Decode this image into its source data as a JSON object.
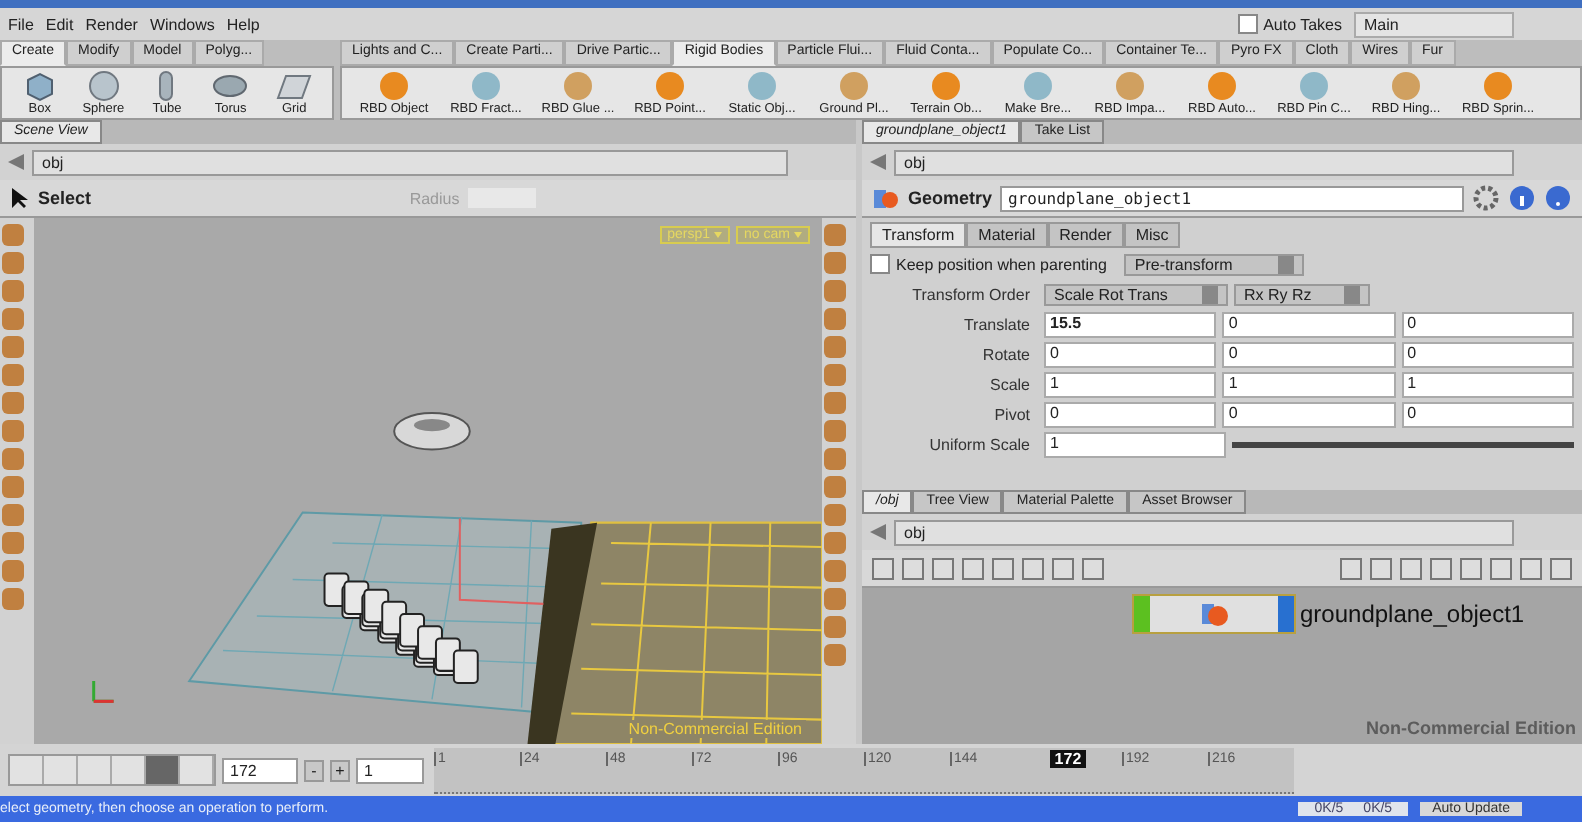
{
  "menu": [
    "File",
    "Edit",
    "Render",
    "Windows",
    "Help"
  ],
  "auto_takes": {
    "label": "Auto Takes",
    "checked": false
  },
  "take": "Main",
  "left_shelf": {
    "tabs": [
      {
        "label": "Create",
        "selected": true
      },
      {
        "label": "Modify",
        "selected": false
      },
      {
        "label": "Model",
        "selected": false
      },
      {
        "label": "Polyg...",
        "selected": false
      }
    ],
    "tools": [
      "Box",
      "Sphere",
      "Tube",
      "Torus",
      "Grid"
    ]
  },
  "right_shelf": {
    "tabs": [
      {
        "label": "Lights and C...",
        "selected": false
      },
      {
        "label": "Create Parti...",
        "selected": false
      },
      {
        "label": "Drive Partic...",
        "selected": false
      },
      {
        "label": "Rigid Bodies",
        "selected": true
      },
      {
        "label": "Particle Flui...",
        "selected": false
      },
      {
        "label": "Fluid Conta...",
        "selected": false
      },
      {
        "label": "Populate Co...",
        "selected": false
      },
      {
        "label": "Container Te...",
        "selected": false
      },
      {
        "label": "Pyro FX",
        "selected": false
      },
      {
        "label": "Cloth",
        "selected": false
      },
      {
        "label": "Wires",
        "selected": false
      },
      {
        "label": "Fur",
        "selected": false
      }
    ],
    "tools": [
      "RBD Object",
      "RBD Fract...",
      "RBD Glue ...",
      "RBD Point...",
      "Static Obj...",
      "Ground Pl...",
      "Terrain Ob...",
      "Make Bre...",
      "RBD Impa...",
      "RBD Auto...",
      "RBD Pin C...",
      "RBD Hing...",
      "RBD Sprin..."
    ]
  },
  "scene_view": {
    "tab": "Scene View",
    "path": "obj",
    "tool": "Select",
    "radius_label": "Radius",
    "camera": "persp1",
    "view": "no cam",
    "edition_label": "Non-Commercial Edition"
  },
  "parameters": {
    "tabs": [
      {
        "label": "groundplane_object1",
        "selected": true
      },
      {
        "label": "Take List",
        "selected": false
      }
    ],
    "path": "obj",
    "node_type": "Geometry",
    "node_name": "groundplane_object1",
    "param_tabs": [
      {
        "label": "Transform",
        "selected": true
      },
      {
        "label": "Material",
        "selected": false
      },
      {
        "label": "Render",
        "selected": false
      },
      {
        "label": "Misc",
        "selected": false
      }
    ],
    "keep_position": {
      "label": "Keep position when parenting",
      "checked": false
    },
    "pre_transform": "Pre-transform",
    "transform_order_label": "Transform Order",
    "transform_order": "Scale Rot Trans",
    "rotate_order": "Rx Ry Rz",
    "rows": [
      {
        "label": "Translate",
        "values": [
          "15.5",
          "0",
          "0"
        ]
      },
      {
        "label": "Rotate",
        "values": [
          "0",
          "0",
          "0"
        ]
      },
      {
        "label": "Scale",
        "values": [
          "1",
          "1",
          "1"
        ]
      },
      {
        "label": "Pivot",
        "values": [
          "0",
          "0",
          "0"
        ]
      }
    ],
    "uniform_scale": {
      "label": "Uniform Scale",
      "value": "1",
      "level": 1
    }
  },
  "network": {
    "tabs": [
      {
        "label": "/obj",
        "selected": true
      },
      {
        "label": "Tree View",
        "selected": false
      },
      {
        "label": "Material Palette",
        "selected": false
      },
      {
        "label": "Asset Browser",
        "selected": false
      }
    ],
    "path": "obj",
    "node_name": "groundplane_object1",
    "edition_label": "Non-Commercial Edition"
  },
  "playbar": {
    "frame": "172",
    "step_buttons": [
      "-",
      "+"
    ],
    "step": "1",
    "ticks": [
      "1",
      "24",
      "48",
      "72",
      "96",
      "120",
      "144",
      "192",
      "216"
    ],
    "current": "172",
    "level": 0.717
  },
  "status": {
    "message": "elect geometry, then choose an operation to perform.",
    "counts": [
      "0K/5",
      "0K/5"
    ],
    "update_mode": "Auto Update"
  }
}
